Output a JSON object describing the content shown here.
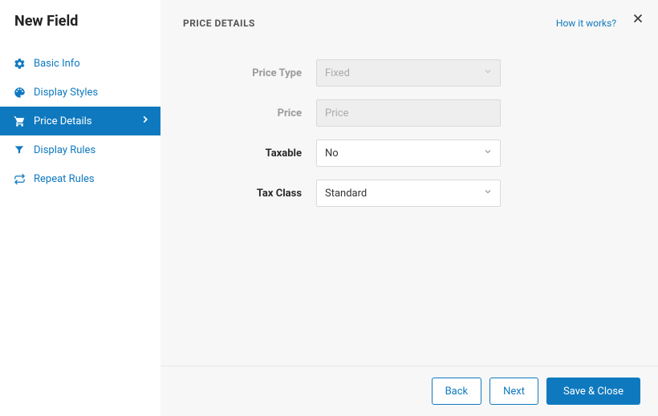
{
  "sidebar": {
    "title": "New Field",
    "items": [
      {
        "label": "Basic Info"
      },
      {
        "label": "Display Styles"
      },
      {
        "label": "Price Details"
      },
      {
        "label": "Display Rules"
      },
      {
        "label": "Repeat Rules"
      }
    ]
  },
  "header": {
    "section_title": "PRICE DETAILS",
    "help_link": "How it works?"
  },
  "form": {
    "price_type": {
      "label": "Price Type",
      "value": "Fixed"
    },
    "price": {
      "label": "Price",
      "placeholder": "Price",
      "value": ""
    },
    "taxable": {
      "label": "Taxable",
      "value": "No"
    },
    "tax_class": {
      "label": "Tax Class",
      "value": "Standard"
    }
  },
  "footer": {
    "back": "Back",
    "next": "Next",
    "save_close": "Save & Close"
  }
}
